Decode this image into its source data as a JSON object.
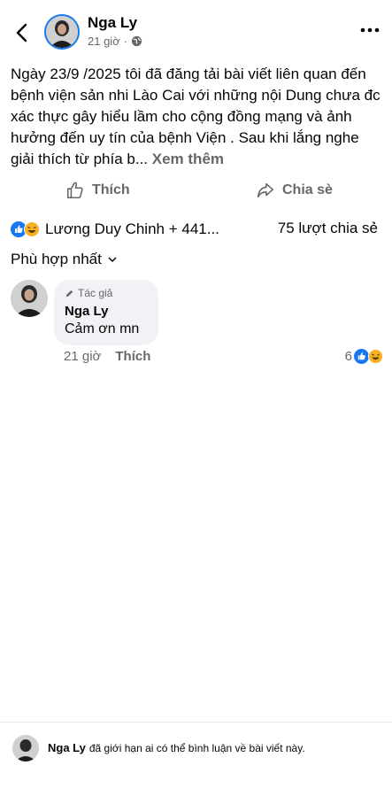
{
  "header": {
    "author": "Nga Ly",
    "time": "21 giờ",
    "dot": "·"
  },
  "post": {
    "text": "Ngày 23/9 /2025  tôi đã đăng tải bài viết liên quan đến bệnh viện sản nhi Lào Cai với những nội Dung chưa đc xác thực gây hiểu lầm cho cộng đồng mạng và ảnh hưởng đến uy tín của bệnh Viện . Sau khi lắng nghe giải thích từ phía b...",
    "see_more": "Xem thêm"
  },
  "actions": {
    "like": "Thích",
    "share": "Chia sè"
  },
  "reactions": {
    "names": "Lương Duy Chinh + 441...",
    "shares": "75 lượt chia sẻ"
  },
  "comments_sort": "Phù hợp nhất",
  "comment": {
    "badge": "Tác giả",
    "name": "Nga Ly",
    "text": "Cảm ơn mn",
    "time": "21 giờ",
    "like": "Thích",
    "reaction_count": "6"
  },
  "footer": {
    "name": "Nga Ly",
    "text": "đã giới hạn ai có thể bình luận về bài viết này."
  },
  "colors": {
    "accent": "#1877f2",
    "secondary_text": "#65676b",
    "bubble_bg": "#f0f2f5",
    "haha": "#f7b125"
  },
  "icons": [
    "back-icon",
    "globe-icon",
    "more-icon",
    "like-icon",
    "share-icon",
    "like-reaction-icon",
    "haha-reaction-icon",
    "chevron-down-icon",
    "pencil-icon"
  ]
}
